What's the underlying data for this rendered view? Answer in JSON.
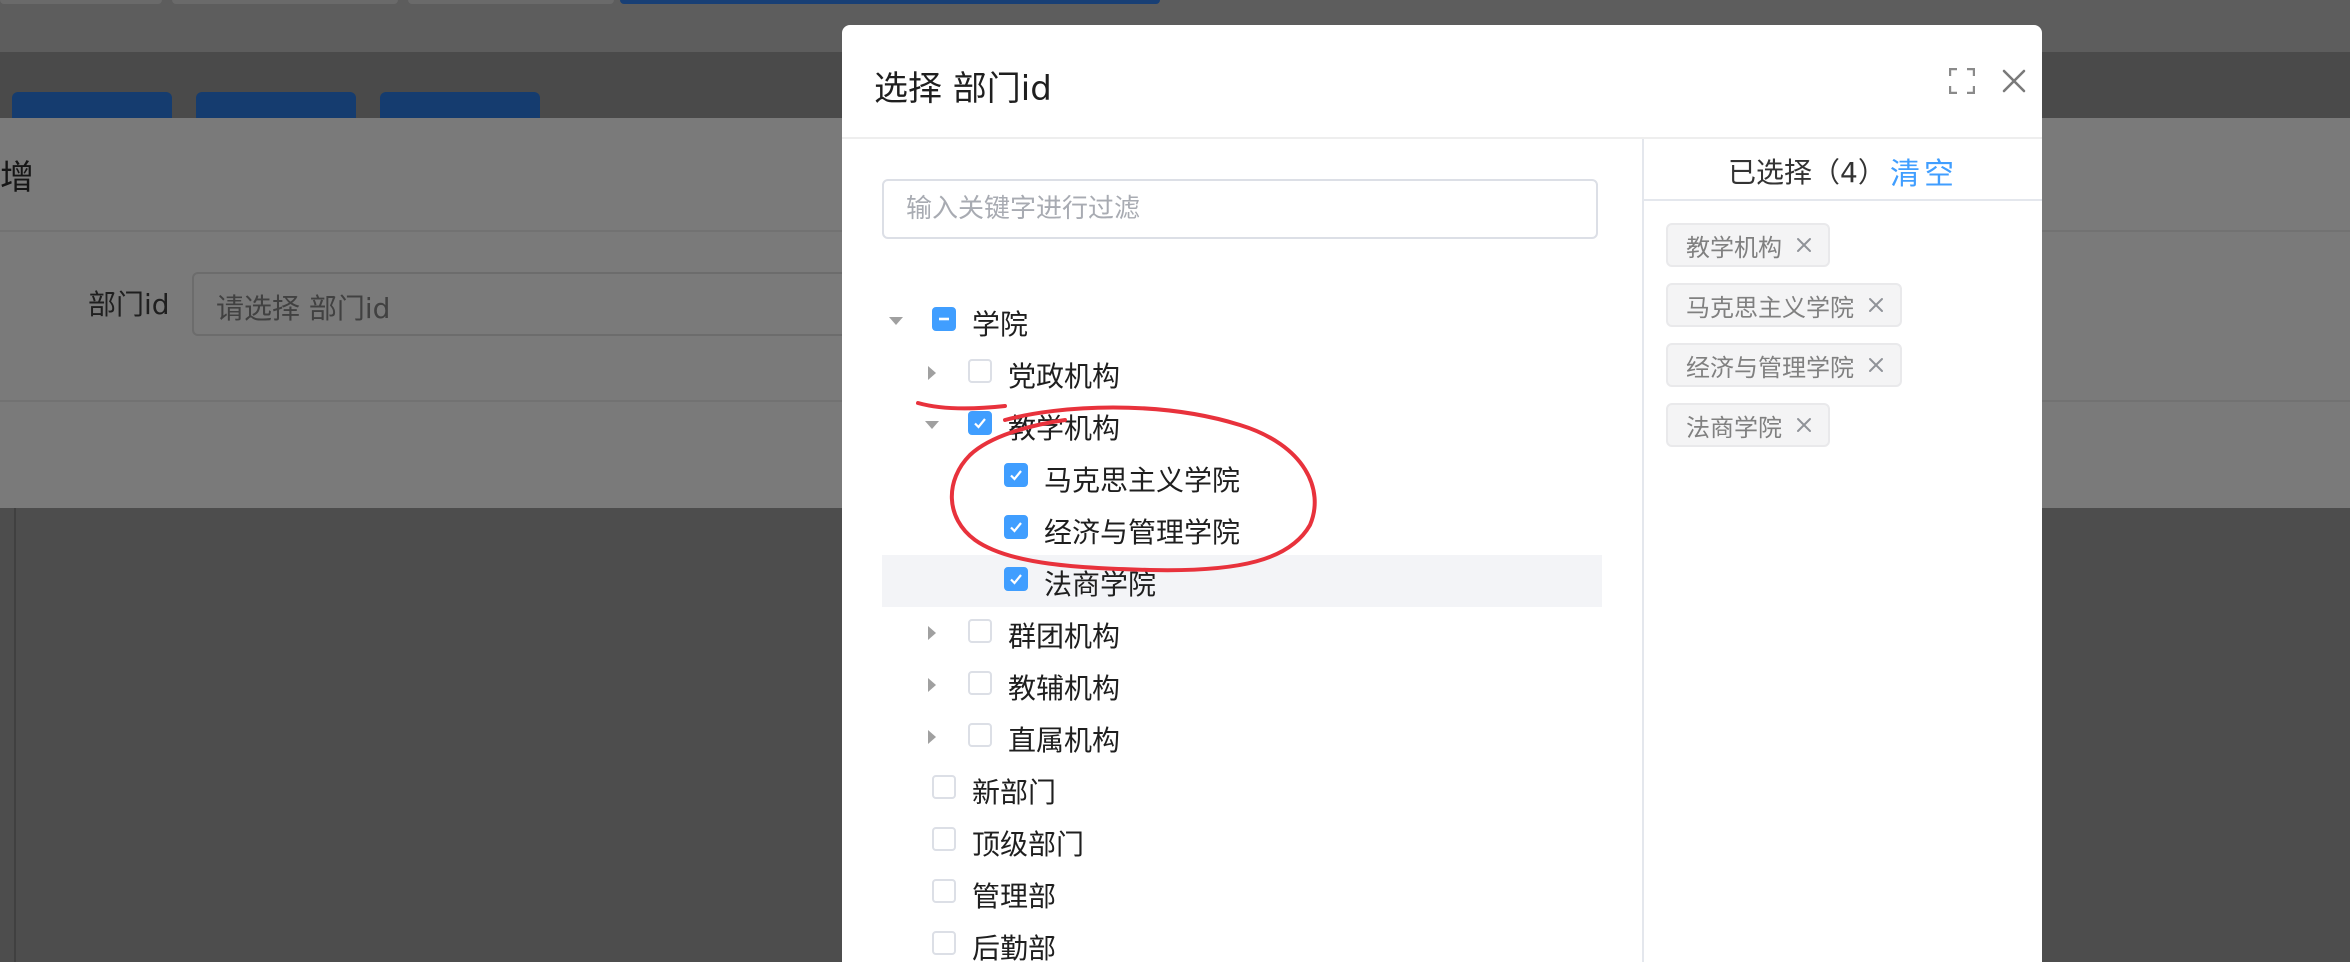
{
  "background": {
    "side_title_fragment": "增",
    "form": {
      "label": "部门id",
      "placeholder": "请选择 部门id"
    }
  },
  "modal": {
    "title": "选择 部门id",
    "icons": {
      "fullscreen": "fullscreen-icon",
      "close": "close-icon"
    },
    "filter": {
      "placeholder": "输入关键字进行过滤",
      "value": ""
    },
    "tree": [
      {
        "label": "学院",
        "level": 0,
        "expandable": true,
        "expanded": true,
        "state": "indeterminate"
      },
      {
        "label": "党政机构",
        "level": 1,
        "expandable": true,
        "expanded": false,
        "state": "unchecked"
      },
      {
        "label": "教学机构",
        "level": 1,
        "expandable": true,
        "expanded": true,
        "state": "checked"
      },
      {
        "label": "马克思主义学院",
        "level": 2,
        "expandable": false,
        "expanded": false,
        "state": "checked"
      },
      {
        "label": "经济与管理学院",
        "level": 2,
        "expandable": false,
        "expanded": false,
        "state": "checked"
      },
      {
        "label": "法商学院",
        "level": 2,
        "expandable": false,
        "expanded": false,
        "state": "checked",
        "highlighted": true
      },
      {
        "label": "群团机构",
        "level": 1,
        "expandable": true,
        "expanded": false,
        "state": "unchecked"
      },
      {
        "label": "教辅机构",
        "level": 1,
        "expandable": true,
        "expanded": false,
        "state": "unchecked"
      },
      {
        "label": "直属机构",
        "level": 1,
        "expandable": true,
        "expanded": false,
        "state": "unchecked"
      },
      {
        "label": "新部门",
        "level": 0,
        "expandable": false,
        "expanded": false,
        "state": "unchecked"
      },
      {
        "label": "顶级部门",
        "level": 0,
        "expandable": false,
        "expanded": false,
        "state": "unchecked"
      },
      {
        "label": "管理部",
        "level": 0,
        "expandable": false,
        "expanded": false,
        "state": "unchecked"
      },
      {
        "label": "后勤部",
        "level": 0,
        "expandable": false,
        "expanded": false,
        "state": "unchecked"
      }
    ],
    "selected_panel": {
      "count_label": "已选择（4）",
      "clear_label": "清空",
      "tags": [
        "教学机构",
        "马克思主义学院",
        "经济与管理学院",
        "法商学院"
      ]
    }
  },
  "colors": {
    "primary": "#409eff",
    "annotation": "#e8323c",
    "text": "#1f1f1f",
    "tag_bg": "#f4f4f5"
  }
}
